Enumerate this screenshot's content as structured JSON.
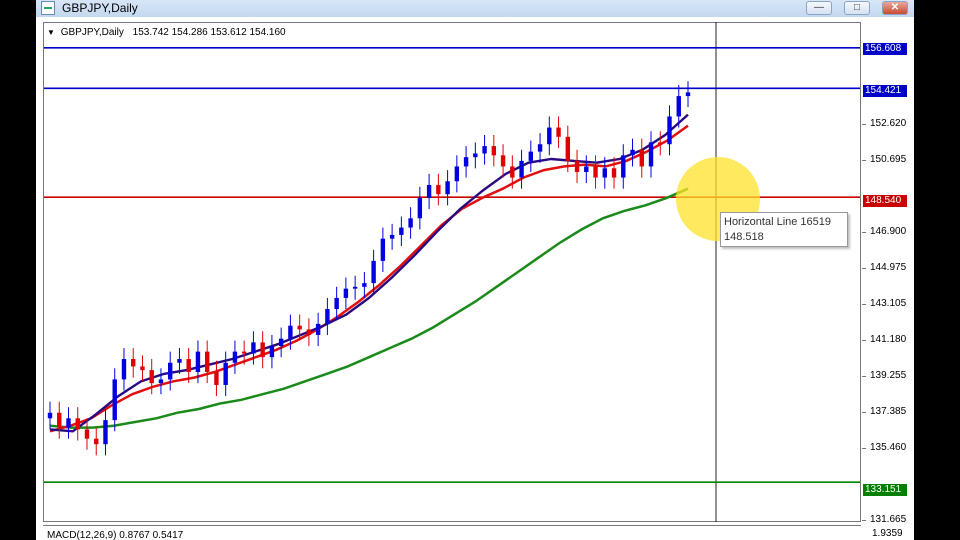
{
  "window": {
    "title": "GBPJPY,Daily",
    "buttons": {
      "minimize": "—",
      "maximize": "□",
      "close": "✕"
    }
  },
  "chart": {
    "symbol_line": "GBPJPY,Daily",
    "ohlc": "153.742 154.286 153.612 154.160",
    "price_ticks": [
      "152.620",
      "150.695",
      "146.900",
      "144.975",
      "143.105",
      "141.180",
      "139.255",
      "137.385",
      "135.460",
      "131.665"
    ],
    "horizontal_lines": [
      {
        "label": "156.608",
        "color": "#0000c8"
      },
      {
        "label": "154.421",
        "color": "#0000c8"
      },
      {
        "label": "148.540",
        "color": "#c80000"
      },
      {
        "label": "133.151",
        "color": "#008000"
      }
    ],
    "tooltip": {
      "name": "Horizontal Line 16519",
      "value": "148.518"
    },
    "macd": {
      "label": "MACD(12,26,9) 0.8767 0.5417",
      "tick": "1.9359"
    }
  },
  "chart_data": {
    "type": "line",
    "title": "GBPJPY,Daily",
    "ylim": [
      131.0,
      158.0
    ],
    "series": [
      {
        "name": "",
        "role": "candles-close",
        "values": [
          136.9,
          136.1,
          136.6,
          136.0,
          135.5,
          135.2,
          136.5,
          138.7,
          139.8,
          139.4,
          139.2,
          138.5,
          138.7,
          139.6,
          139.8,
          139.1,
          140.2,
          139.1,
          138.4,
          139.6,
          140.2,
          140.1,
          140.7,
          139.9,
          140.5,
          140.9,
          141.6,
          141.4,
          141.1,
          141.7,
          142.5,
          143.1,
          143.6,
          143.7,
          143.9,
          145.1,
          146.3,
          146.5,
          146.9,
          147.4,
          148.5,
          149.2,
          148.7,
          149.4,
          150.2,
          150.7,
          150.9,
          151.3,
          150.8,
          150.2,
          149.6,
          150.5,
          151.0,
          151.4,
          152.3,
          151.8,
          150.5,
          149.9,
          150.2,
          149.6,
          150.1,
          149.6,
          150.8,
          151.1,
          150.2,
          151.5,
          151.4,
          152.9,
          154.0,
          154.2
        ]
      },
      {
        "name": "",
        "role": "ma-green",
        "values": [
          136.2,
          136.1,
          136.1,
          136.2,
          136.4,
          136.6,
          136.9,
          137.1,
          137.4,
          137.6,
          137.9,
          138.2,
          138.6,
          139.0,
          139.4,
          139.9,
          140.4,
          140.9,
          141.5,
          142.2,
          142.9,
          143.7,
          144.5,
          145.3,
          146.1,
          146.8,
          147.4,
          147.8,
          148.1,
          148.5,
          149.0
        ]
      },
      {
        "name": "",
        "role": "ma-red",
        "values": [
          135.9,
          136.2,
          136.6,
          137.3,
          137.9,
          138.3,
          138.6,
          138.8,
          139.1,
          139.5,
          139.9,
          140.3,
          140.8,
          141.4,
          142.1,
          142.9,
          143.8,
          144.8,
          145.9,
          147.0,
          147.9,
          148.5,
          149.0,
          149.6,
          150.0,
          150.2,
          150.3,
          150.2,
          150.5,
          151.0,
          151.6,
          152.4
        ]
      },
      {
        "name": "",
        "role": "ma-navy",
        "values": [
          136.0,
          135.9,
          136.8,
          137.8,
          138.6,
          139.0,
          139.2,
          139.5,
          139.8,
          140.2,
          140.6,
          141.1,
          141.6,
          142.2,
          143.1,
          144.2,
          145.4,
          146.7,
          147.9,
          148.9,
          149.8,
          150.4,
          150.6,
          150.5,
          150.4,
          150.6,
          151.1,
          151.9,
          153.0
        ]
      }
    ]
  }
}
